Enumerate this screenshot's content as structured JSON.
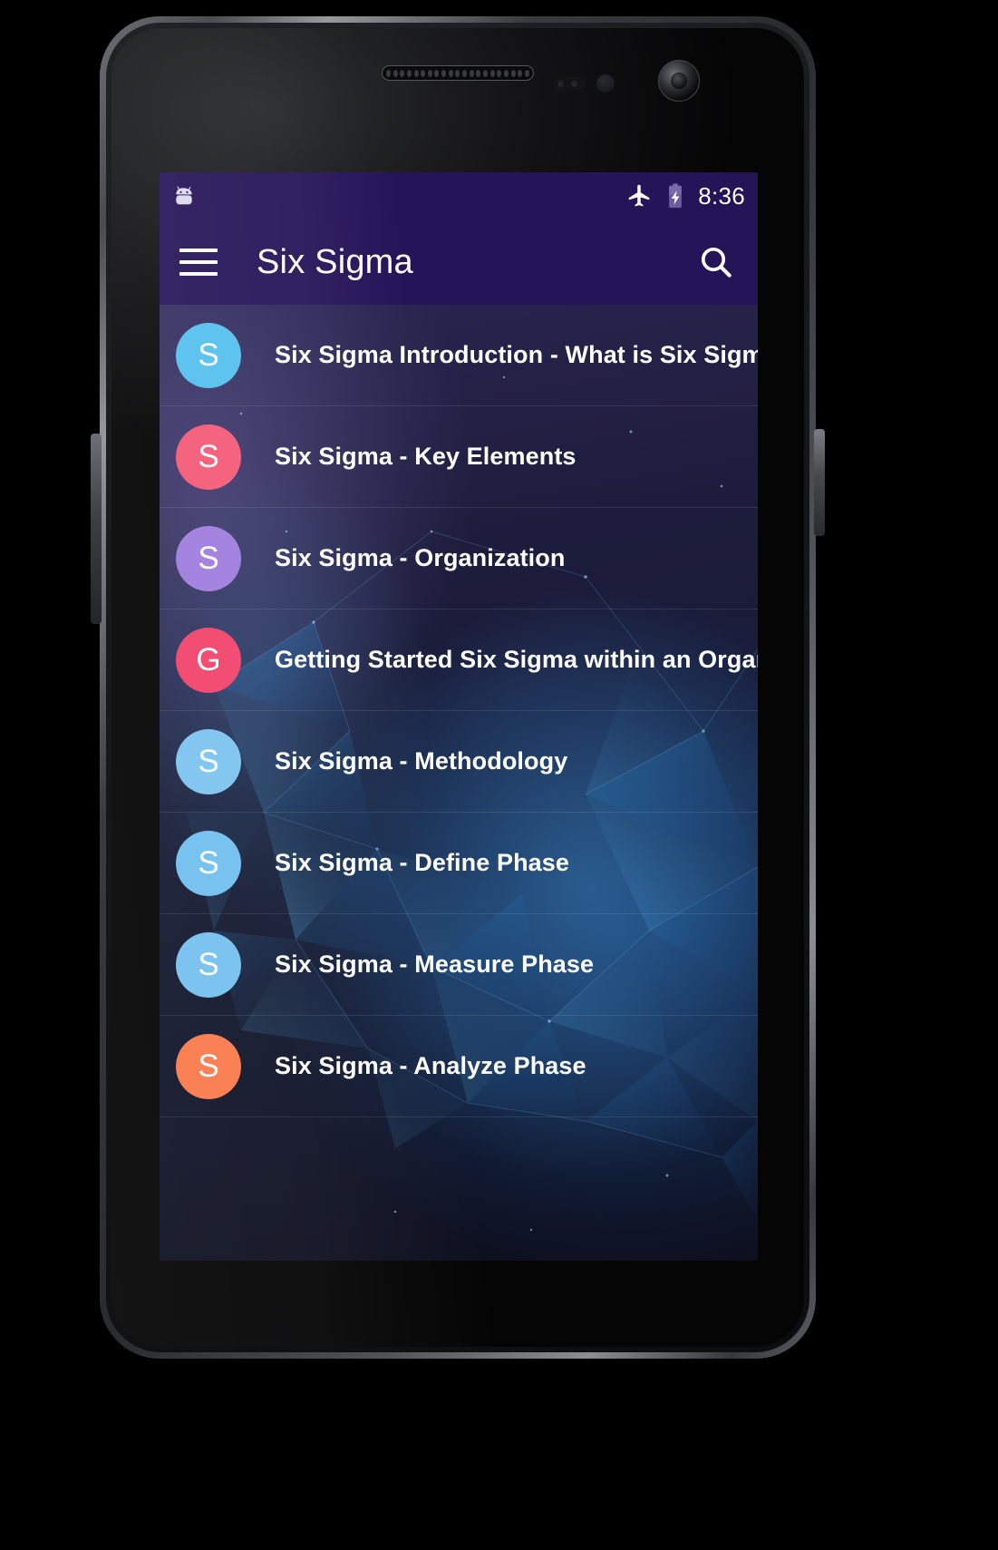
{
  "device": {
    "name": "android-phone-mockup",
    "earpiece_icon": "speaker-grille-icon",
    "front_camera_icon": "front-camera-icon",
    "proximity_sensor_icon": "proximity-sensor-icon"
  },
  "status_bar": {
    "notification_icon": "android-notification-icon",
    "airplane_mode_icon": "airplane-mode-icon",
    "battery_icon": "battery-charging-icon",
    "time": "8:36"
  },
  "app_bar": {
    "menu_icon": "hamburger-menu-icon",
    "title": "Six Sigma",
    "search_icon": "search-icon"
  },
  "theme": {
    "toolbar_color": "#261459",
    "status_bar_color": "#261459",
    "title_color": "#ffffff",
    "item_title_color": "#ffffff",
    "divider_color": "rgba(255,255,255,0.10)",
    "nav_bar_color": "#000000"
  },
  "list": {
    "items": [
      {
        "initial": "S",
        "color": "#5ec3ef",
        "title": "Six Sigma Introduction - What is Six Sigma"
      },
      {
        "initial": "S",
        "color": "#f4647f",
        "title": "Six Sigma - Key Elements"
      },
      {
        "initial": "S",
        "color": "#a583e0",
        "title": "Six Sigma - Organization"
      },
      {
        "initial": "G",
        "color": "#f24d72",
        "title": "Getting Started Six Sigma within an Organization"
      },
      {
        "initial": "S",
        "color": "#83c7f0",
        "title": "Six Sigma - Methodology"
      },
      {
        "initial": "S",
        "color": "#77c2ef",
        "title": "Six Sigma - Define Phase"
      },
      {
        "initial": "S",
        "color": "#7cc4ef",
        "title": "Six Sigma - Measure Phase"
      },
      {
        "initial": "S",
        "color": "#f98155",
        "title": "Six Sigma - Analyze Phase"
      }
    ]
  },
  "nav_bar": {
    "back_label": "back-button",
    "home_label": "home-button",
    "recents_label": "recents-button"
  }
}
